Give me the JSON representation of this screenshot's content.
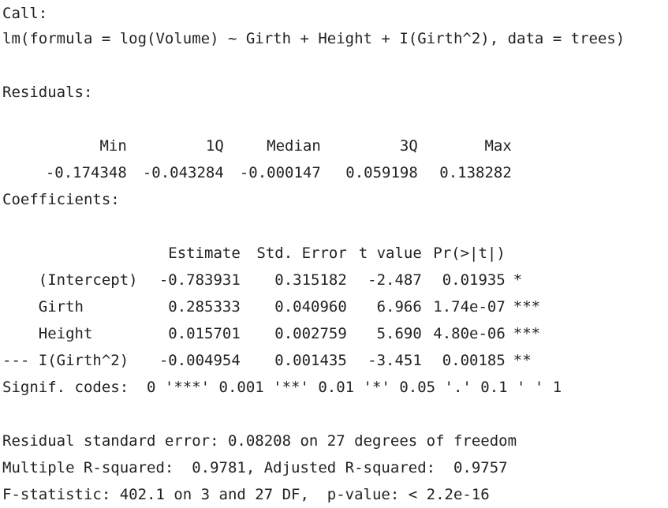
{
  "call": {
    "header": "Call:",
    "formula": "lm(formula = log(Volume) ~ Girth + Height + I(Girth^2), data = trees)"
  },
  "residuals": {
    "header": "Residuals:",
    "columns": [
      "Min",
      "1Q",
      "Median",
      "3Q",
      "Max"
    ],
    "values": [
      "-0.174348",
      "-0.043284",
      "-0.000147",
      "0.059198",
      "0.138282"
    ]
  },
  "coefficients": {
    "header": "Coefficients:",
    "columns": [
      "Estimate",
      "Std. Error",
      "t value",
      "Pr(>|t|)"
    ],
    "rows": [
      {
        "name": "(Intercept)",
        "estimate": "-0.783931",
        "std_error": "0.315182",
        "t_value": "-2.487",
        "p_value": "0.01935",
        "signif": "*"
      },
      {
        "name": "Girth",
        "estimate": "0.285333",
        "std_error": "0.040960",
        "t_value": "6.966",
        "p_value": "1.74e-07",
        "signif": "***"
      },
      {
        "name": "Height",
        "estimate": "0.015701",
        "std_error": "0.002759",
        "t_value": "5.690",
        "p_value": "4.80e-06",
        "signif": "***"
      },
      {
        "name": "I(Girth^2)",
        "estimate": "-0.004954",
        "std_error": "0.001435",
        "t_value": "-3.451",
        "p_value": "0.00185",
        "signif": "**"
      }
    ],
    "separator": "---",
    "signif_codes": "Signif. codes:  0 '***' 0.001 '**' 0.01 '*' 0.05 '.' 0.1 ' ' 1"
  },
  "summary": {
    "residual_se": "Residual standard error: 0.08208 on 27 degrees of freedom",
    "r_squared": "Multiple R-squared:  0.9781, Adjusted R-squared:  0.9757",
    "f_statistic": "F-statistic: 402.1 on 3 and 27 DF,  p-value: < 2.2e-16"
  }
}
